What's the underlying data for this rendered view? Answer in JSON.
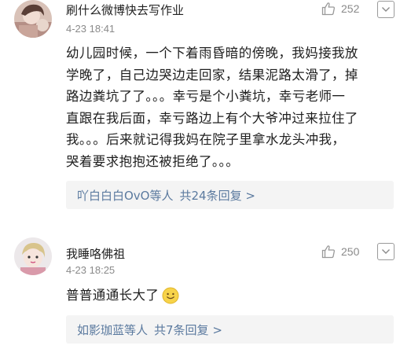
{
  "comments": [
    {
      "username": "刷什么微博快去写作业",
      "time": "4-23 18:41",
      "likes": "252",
      "text_lines": [
        "幼儿园时候，一个下着雨昏暗的傍晚，我妈接我放",
        "学晚了，自己边哭边走回家，结果泥路太滑了，掉",
        "路边粪坑了了。。。幸亏是个小粪坑，幸亏老师一",
        "直跟在我后面，幸亏路边上有个大爷冲过来拉住了",
        "我。。。后来就记得我妈在院子里拿水龙头冲我，",
        "哭着要求抱抱还被拒绝了。。。"
      ],
      "replies_users": "吖白白白OvO等人",
      "replies_count": "共24条回复 >"
    },
    {
      "username": "我睡咯佛祖",
      "time": "4-23 18:25",
      "likes": "250",
      "text": "普普通通长大了",
      "emoji": "smile-emoji",
      "replies_users": "如影珈蓝等人",
      "replies_count": "共7条回复 >"
    }
  ],
  "colors": {
    "link": "#5b7a9f",
    "meta": "#8a8a8a",
    "reply_bg": "#f4f4f4"
  }
}
